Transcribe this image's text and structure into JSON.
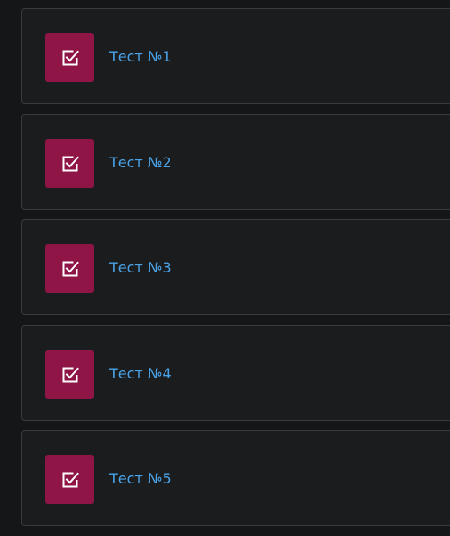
{
  "items": [
    {
      "title": "Тест №1",
      "icon": "checkbox-checked-icon"
    },
    {
      "title": "Тест №2",
      "icon": "checkbox-checked-icon"
    },
    {
      "title": "Тест №3",
      "icon": "checkbox-checked-icon"
    },
    {
      "title": "Тест №4",
      "icon": "checkbox-checked-icon"
    },
    {
      "title": "Тест №5",
      "icon": "checkbox-checked-icon"
    }
  ],
  "colors": {
    "background": "#151618",
    "card": "#1b1c1e",
    "card_border": "#3a3b3d",
    "accent_tile": "#8f1547",
    "link": "#4aa3e8"
  }
}
